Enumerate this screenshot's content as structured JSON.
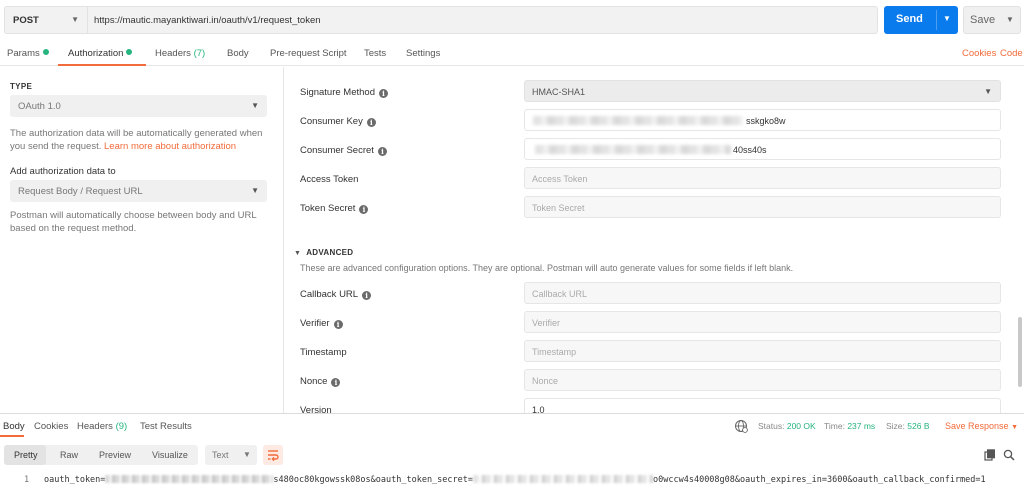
{
  "request": {
    "method": "POST",
    "url": "https://mautic.mayanktiwari.in/oauth/v1/request_token",
    "send_label": "Send",
    "save_label": "Save"
  },
  "tabs": {
    "params": "Params",
    "authorization": "Authorization",
    "headers": "Headers",
    "headers_count": "(7)",
    "body": "Body",
    "prerequest": "Pre-request Script",
    "tests": "Tests",
    "settings": "Settings",
    "cookies": "Cookies",
    "code": "Code"
  },
  "auth_left": {
    "type_label": "TYPE",
    "type_value": "OAuth 1.0",
    "desc_line1": "The authorization data will be automatically generated when",
    "desc_line2": "you send the request.",
    "learn_more": "Learn more about authorization",
    "add_label": "Add authorization data to",
    "add_value": "Request Body / Request URL",
    "note_line1": "Postman will automatically choose between body and URL",
    "note_line2": "based on the request method."
  },
  "auth_form": {
    "signature_method_label": "Signature Method",
    "signature_method_value": "HMAC-SHA1",
    "consumer_key_label": "Consumer Key",
    "consumer_key_value": "sskgko8w",
    "consumer_secret_label": "Consumer Secret",
    "consumer_secret_value": "40ss40s",
    "access_token_label": "Access Token",
    "access_token_placeholder": "Access Token",
    "token_secret_label": "Token Secret",
    "token_secret_placeholder": "Token Secret",
    "advanced_label": "ADVANCED",
    "advanced_desc": "These are advanced configuration options. They are optional. Postman will auto generate values for some fields if left blank.",
    "callback_url_label": "Callback URL",
    "callback_url_placeholder": "Callback URL",
    "verifier_label": "Verifier",
    "verifier_placeholder": "Verifier",
    "timestamp_label": "Timestamp",
    "timestamp_placeholder": "Timestamp",
    "nonce_label": "Nonce",
    "nonce_placeholder": "Nonce",
    "version_label": "Version",
    "version_value": "1.0"
  },
  "response": {
    "tabs": {
      "body": "Body",
      "cookies": "Cookies",
      "headers": "Headers",
      "headers_count": "(9)",
      "test_results": "Test Results"
    },
    "status_label": "Status:",
    "status_value": "200 OK",
    "time_label": "Time:",
    "time_value": "237 ms",
    "size_label": "Size:",
    "size_value": "526 B",
    "save_response": "Save Response",
    "view_tabs": {
      "pretty": "Pretty",
      "raw": "Raw",
      "preview": "Preview",
      "visualize": "Visualize"
    },
    "format": "Text",
    "line_number": "1",
    "code_part1": "oauth_token=",
    "code_part2": "s480oc80kgowssk08os&oauth_token_secret=",
    "code_part3": "o0wccw4s40008g08&oauth_expires_in=3600&oauth_callback_confirmed=1"
  },
  "icons": {
    "info": "info-icon",
    "caret": "chevron-down-icon",
    "globe": "globe-icon",
    "wrap": "wrap-icon",
    "copy": "copy-icon",
    "search": "search-icon"
  },
  "colors": {
    "accent": "#f26b3a",
    "send": "#097bed",
    "success": "#26b47f"
  }
}
